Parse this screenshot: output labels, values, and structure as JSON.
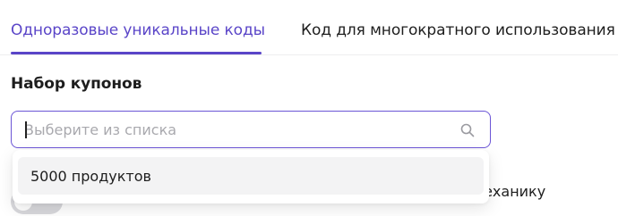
{
  "tabs": [
    {
      "label": "Одноразовые уникальные коды",
      "active": true
    },
    {
      "label": "Код для многократного использования",
      "active": false
    }
  ],
  "form": {
    "label": "Набор купонов",
    "select_placeholder": "Выберите из списка",
    "select_value": ""
  },
  "dropdown": {
    "options": [
      {
        "label": "5000 продуктов"
      }
    ]
  },
  "partially_hidden_row": {
    "text_visible": "механику"
  },
  "colors": {
    "accent": "#5a45c8",
    "input_border": "#6b55d6",
    "toggle_off": "#d8d8dc",
    "option_hover_bg": "#f3f3f4"
  },
  "icons": {
    "search": "search-icon"
  }
}
